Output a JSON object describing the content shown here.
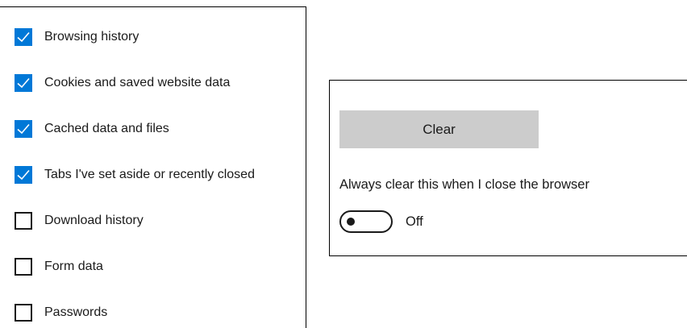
{
  "clear_data_options": [
    {
      "label": "Browsing history",
      "checked": true
    },
    {
      "label": "Cookies and saved website data",
      "checked": true
    },
    {
      "label": "Cached data and files",
      "checked": true
    },
    {
      "label": "Tabs I've set aside or recently closed",
      "checked": true
    },
    {
      "label": "Download history",
      "checked": false
    },
    {
      "label": "Form data",
      "checked": false
    },
    {
      "label": "Passwords",
      "checked": false
    }
  ],
  "clear_button": {
    "label": "Clear"
  },
  "always_clear": {
    "label": "Always clear this when I close the browser",
    "toggle_state": "Off",
    "toggle_on": false
  },
  "colors": {
    "checkbox_checked": "#0078d7",
    "button_background": "#cccccc"
  },
  "icons": {
    "checkmark": "checkmark-icon"
  }
}
